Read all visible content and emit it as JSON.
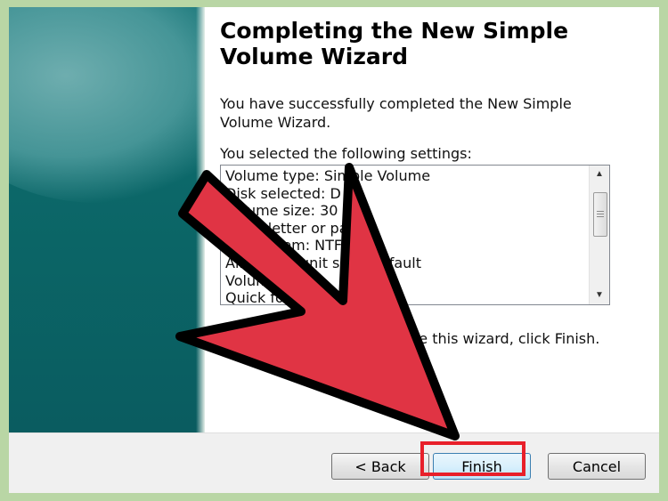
{
  "wizard": {
    "title": "Completing the New Simple Volume Wizard",
    "intro": "You have successfully completed the New Simple Volume Wizard.",
    "settings_label": "You selected the following settings:",
    "settings": [
      "Volume type: Simple Volume",
      "Disk selected: D",
      "Volume size: 30 MB",
      "Drive letter or path",
      "File system: NTFS",
      "Allocation unit size: Default",
      "Volume label",
      "Quick format"
    ],
    "close_hint": "To close this wizard, click Finish."
  },
  "buttons": {
    "back": "< Back",
    "finish": "Finish",
    "cancel": "Cancel"
  },
  "annotation": {
    "arrow_color": "#e03444",
    "highlight_color": "#e8202a"
  }
}
